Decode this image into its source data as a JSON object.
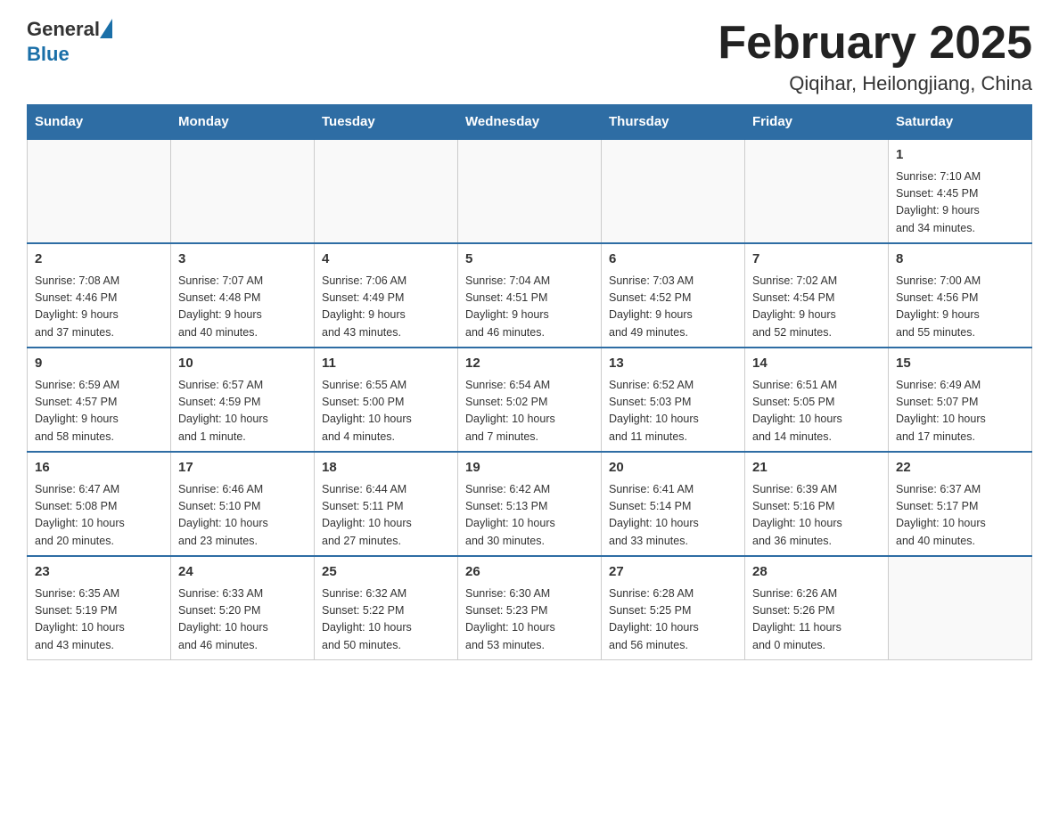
{
  "header": {
    "logo_general": "General",
    "logo_blue": "Blue",
    "title": "February 2025",
    "subtitle": "Qiqihar, Heilongjiang, China"
  },
  "days_of_week": [
    "Sunday",
    "Monday",
    "Tuesday",
    "Wednesday",
    "Thursday",
    "Friday",
    "Saturday"
  ],
  "weeks": [
    [
      {
        "day": "",
        "info": ""
      },
      {
        "day": "",
        "info": ""
      },
      {
        "day": "",
        "info": ""
      },
      {
        "day": "",
        "info": ""
      },
      {
        "day": "",
        "info": ""
      },
      {
        "day": "",
        "info": ""
      },
      {
        "day": "1",
        "info": "Sunrise: 7:10 AM\nSunset: 4:45 PM\nDaylight: 9 hours\nand 34 minutes."
      }
    ],
    [
      {
        "day": "2",
        "info": "Sunrise: 7:08 AM\nSunset: 4:46 PM\nDaylight: 9 hours\nand 37 minutes."
      },
      {
        "day": "3",
        "info": "Sunrise: 7:07 AM\nSunset: 4:48 PM\nDaylight: 9 hours\nand 40 minutes."
      },
      {
        "day": "4",
        "info": "Sunrise: 7:06 AM\nSunset: 4:49 PM\nDaylight: 9 hours\nand 43 minutes."
      },
      {
        "day": "5",
        "info": "Sunrise: 7:04 AM\nSunset: 4:51 PM\nDaylight: 9 hours\nand 46 minutes."
      },
      {
        "day": "6",
        "info": "Sunrise: 7:03 AM\nSunset: 4:52 PM\nDaylight: 9 hours\nand 49 minutes."
      },
      {
        "day": "7",
        "info": "Sunrise: 7:02 AM\nSunset: 4:54 PM\nDaylight: 9 hours\nand 52 minutes."
      },
      {
        "day": "8",
        "info": "Sunrise: 7:00 AM\nSunset: 4:56 PM\nDaylight: 9 hours\nand 55 minutes."
      }
    ],
    [
      {
        "day": "9",
        "info": "Sunrise: 6:59 AM\nSunset: 4:57 PM\nDaylight: 9 hours\nand 58 minutes."
      },
      {
        "day": "10",
        "info": "Sunrise: 6:57 AM\nSunset: 4:59 PM\nDaylight: 10 hours\nand 1 minute."
      },
      {
        "day": "11",
        "info": "Sunrise: 6:55 AM\nSunset: 5:00 PM\nDaylight: 10 hours\nand 4 minutes."
      },
      {
        "day": "12",
        "info": "Sunrise: 6:54 AM\nSunset: 5:02 PM\nDaylight: 10 hours\nand 7 minutes."
      },
      {
        "day": "13",
        "info": "Sunrise: 6:52 AM\nSunset: 5:03 PM\nDaylight: 10 hours\nand 11 minutes."
      },
      {
        "day": "14",
        "info": "Sunrise: 6:51 AM\nSunset: 5:05 PM\nDaylight: 10 hours\nand 14 minutes."
      },
      {
        "day": "15",
        "info": "Sunrise: 6:49 AM\nSunset: 5:07 PM\nDaylight: 10 hours\nand 17 minutes."
      }
    ],
    [
      {
        "day": "16",
        "info": "Sunrise: 6:47 AM\nSunset: 5:08 PM\nDaylight: 10 hours\nand 20 minutes."
      },
      {
        "day": "17",
        "info": "Sunrise: 6:46 AM\nSunset: 5:10 PM\nDaylight: 10 hours\nand 23 minutes."
      },
      {
        "day": "18",
        "info": "Sunrise: 6:44 AM\nSunset: 5:11 PM\nDaylight: 10 hours\nand 27 minutes."
      },
      {
        "day": "19",
        "info": "Sunrise: 6:42 AM\nSunset: 5:13 PM\nDaylight: 10 hours\nand 30 minutes."
      },
      {
        "day": "20",
        "info": "Sunrise: 6:41 AM\nSunset: 5:14 PM\nDaylight: 10 hours\nand 33 minutes."
      },
      {
        "day": "21",
        "info": "Sunrise: 6:39 AM\nSunset: 5:16 PM\nDaylight: 10 hours\nand 36 minutes."
      },
      {
        "day": "22",
        "info": "Sunrise: 6:37 AM\nSunset: 5:17 PM\nDaylight: 10 hours\nand 40 minutes."
      }
    ],
    [
      {
        "day": "23",
        "info": "Sunrise: 6:35 AM\nSunset: 5:19 PM\nDaylight: 10 hours\nand 43 minutes."
      },
      {
        "day": "24",
        "info": "Sunrise: 6:33 AM\nSunset: 5:20 PM\nDaylight: 10 hours\nand 46 minutes."
      },
      {
        "day": "25",
        "info": "Sunrise: 6:32 AM\nSunset: 5:22 PM\nDaylight: 10 hours\nand 50 minutes."
      },
      {
        "day": "26",
        "info": "Sunrise: 6:30 AM\nSunset: 5:23 PM\nDaylight: 10 hours\nand 53 minutes."
      },
      {
        "day": "27",
        "info": "Sunrise: 6:28 AM\nSunset: 5:25 PM\nDaylight: 10 hours\nand 56 minutes."
      },
      {
        "day": "28",
        "info": "Sunrise: 6:26 AM\nSunset: 5:26 PM\nDaylight: 11 hours\nand 0 minutes."
      },
      {
        "day": "",
        "info": ""
      }
    ]
  ]
}
